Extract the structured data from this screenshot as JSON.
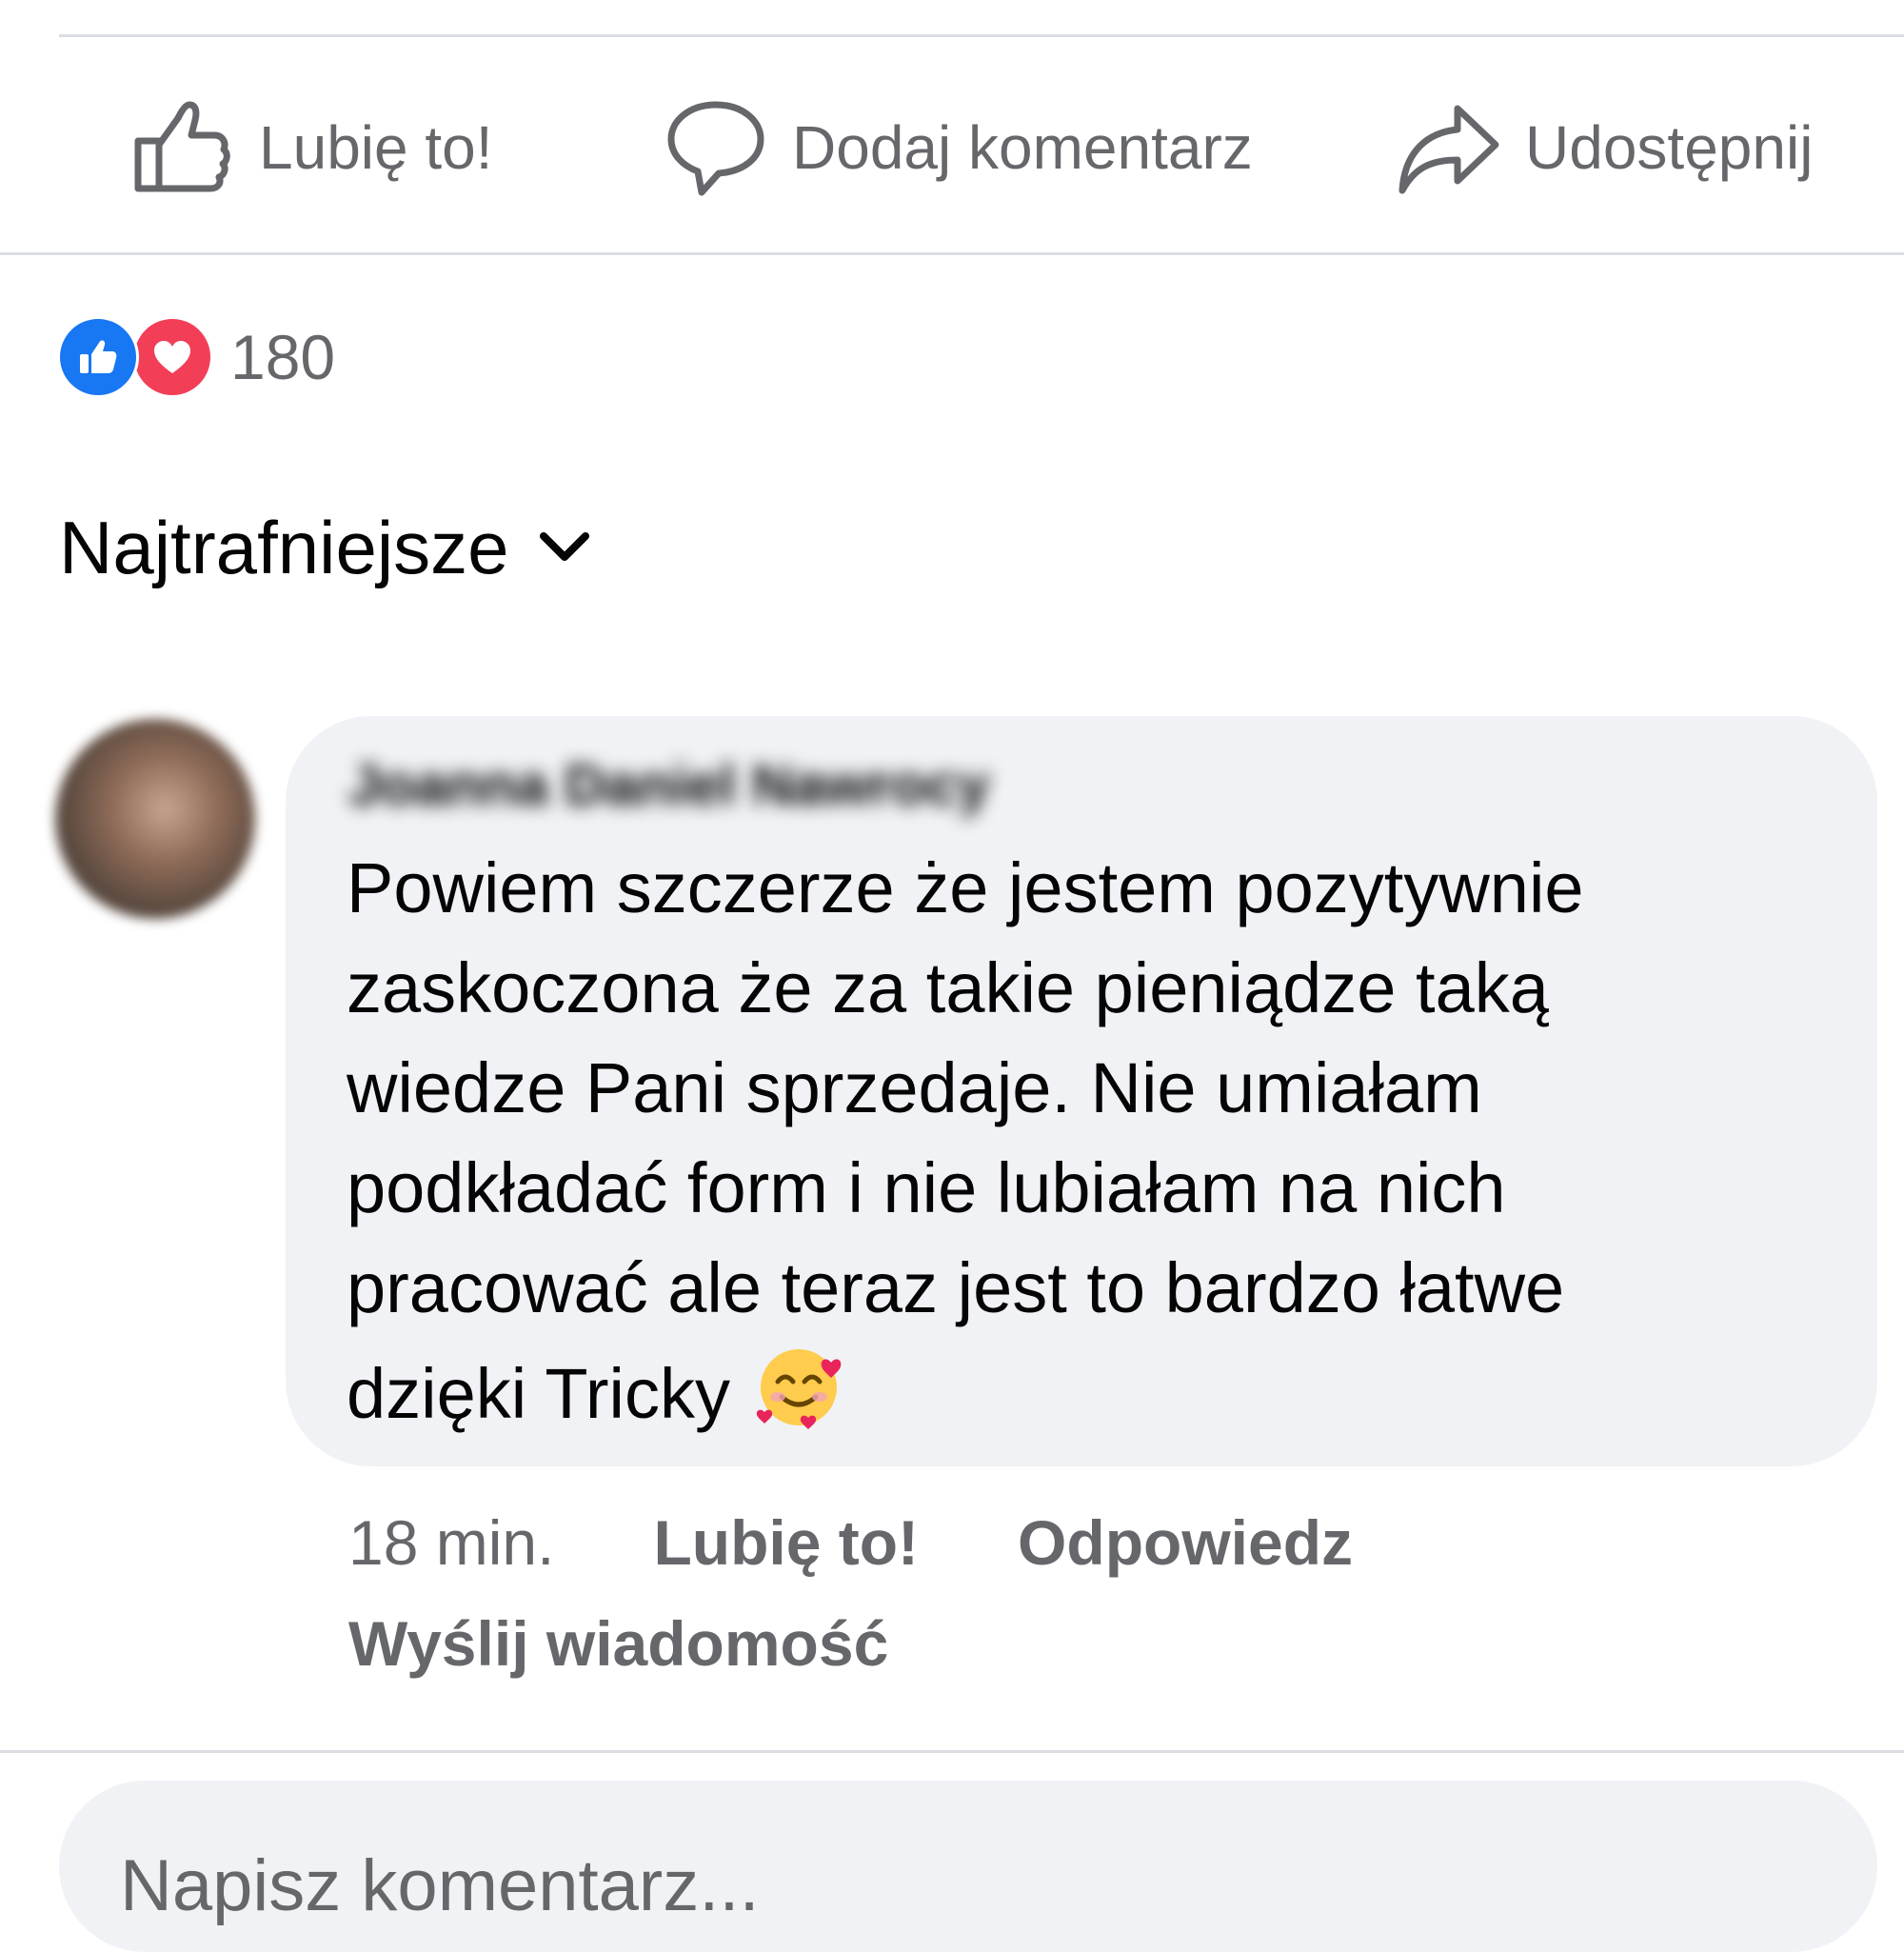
{
  "actions": {
    "like_label": "Lubię to!",
    "comment_label": "Dodaj komentarz",
    "share_label": "Udostępnij"
  },
  "reactions": {
    "types": [
      "like",
      "love"
    ],
    "count": "180",
    "colors": {
      "like": "#1877f2",
      "love": "#f33e58"
    }
  },
  "sort": {
    "label": "Najtrafniejsze"
  },
  "comment": {
    "author": "Joanna Daniel Nawrocy",
    "text_lines": [
      "Powiem szczerze że jestem pozytywnie",
      "zaskoczona że za takie pieniądze taką",
      "wiedze Pani sprzedaje. Nie umiałam",
      "podkładać form i nie lubiałam na nich",
      "pracować ale teraz jest to bardzo łatwe",
      "dzięki Tricky"
    ],
    "emoji": "smiling-face-with-hearts",
    "timestamp": "18 min.",
    "like_label": "Lubię to!",
    "reply_label": "Odpowiedz",
    "send_message_label": "Wyślij wiadomość"
  },
  "composer": {
    "placeholder": "Napisz komentarz..."
  },
  "colors": {
    "text_primary": "#050505",
    "text_secondary": "#65676b",
    "bubble_bg": "#f0f2f5",
    "divider": "#dadde1"
  }
}
